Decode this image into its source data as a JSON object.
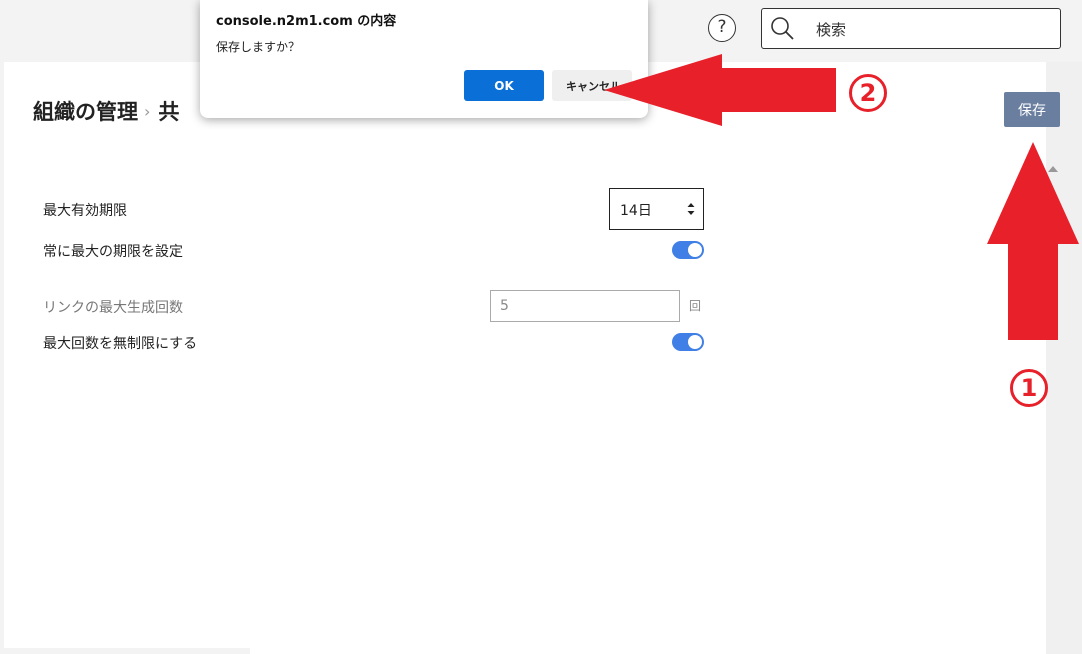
{
  "header": {
    "help_icon_glyph": "?",
    "search_placeholder": "検索"
  },
  "breadcrumb": {
    "root": "組織の管理",
    "separator": "›",
    "current": "共"
  },
  "toolbar": {
    "save_label": "保存"
  },
  "settings": {
    "max_expiry_label": "最大有効期限",
    "max_expiry_value": "14日",
    "always_max_label": "常に最大の期限を設定",
    "always_max_on": true,
    "link_max_count_label": "リンクの最大生成回数",
    "link_max_count_value": "5",
    "link_max_count_unit": "回",
    "unlimited_label": "最大回数を無制限にする",
    "unlimited_on": true
  },
  "dialog": {
    "title": "console.n2m1.com の内容",
    "message": "保存しますか？",
    "ok_label": "OK",
    "cancel_label": "キャンセル"
  },
  "annotations": {
    "badge_1": "1",
    "badge_2": "2",
    "color": "#e8202a"
  },
  "colors": {
    "save_button": "#6a7fa0",
    "toggle_on": "#3f7fe6",
    "ok_button": "#0a6fd6"
  }
}
